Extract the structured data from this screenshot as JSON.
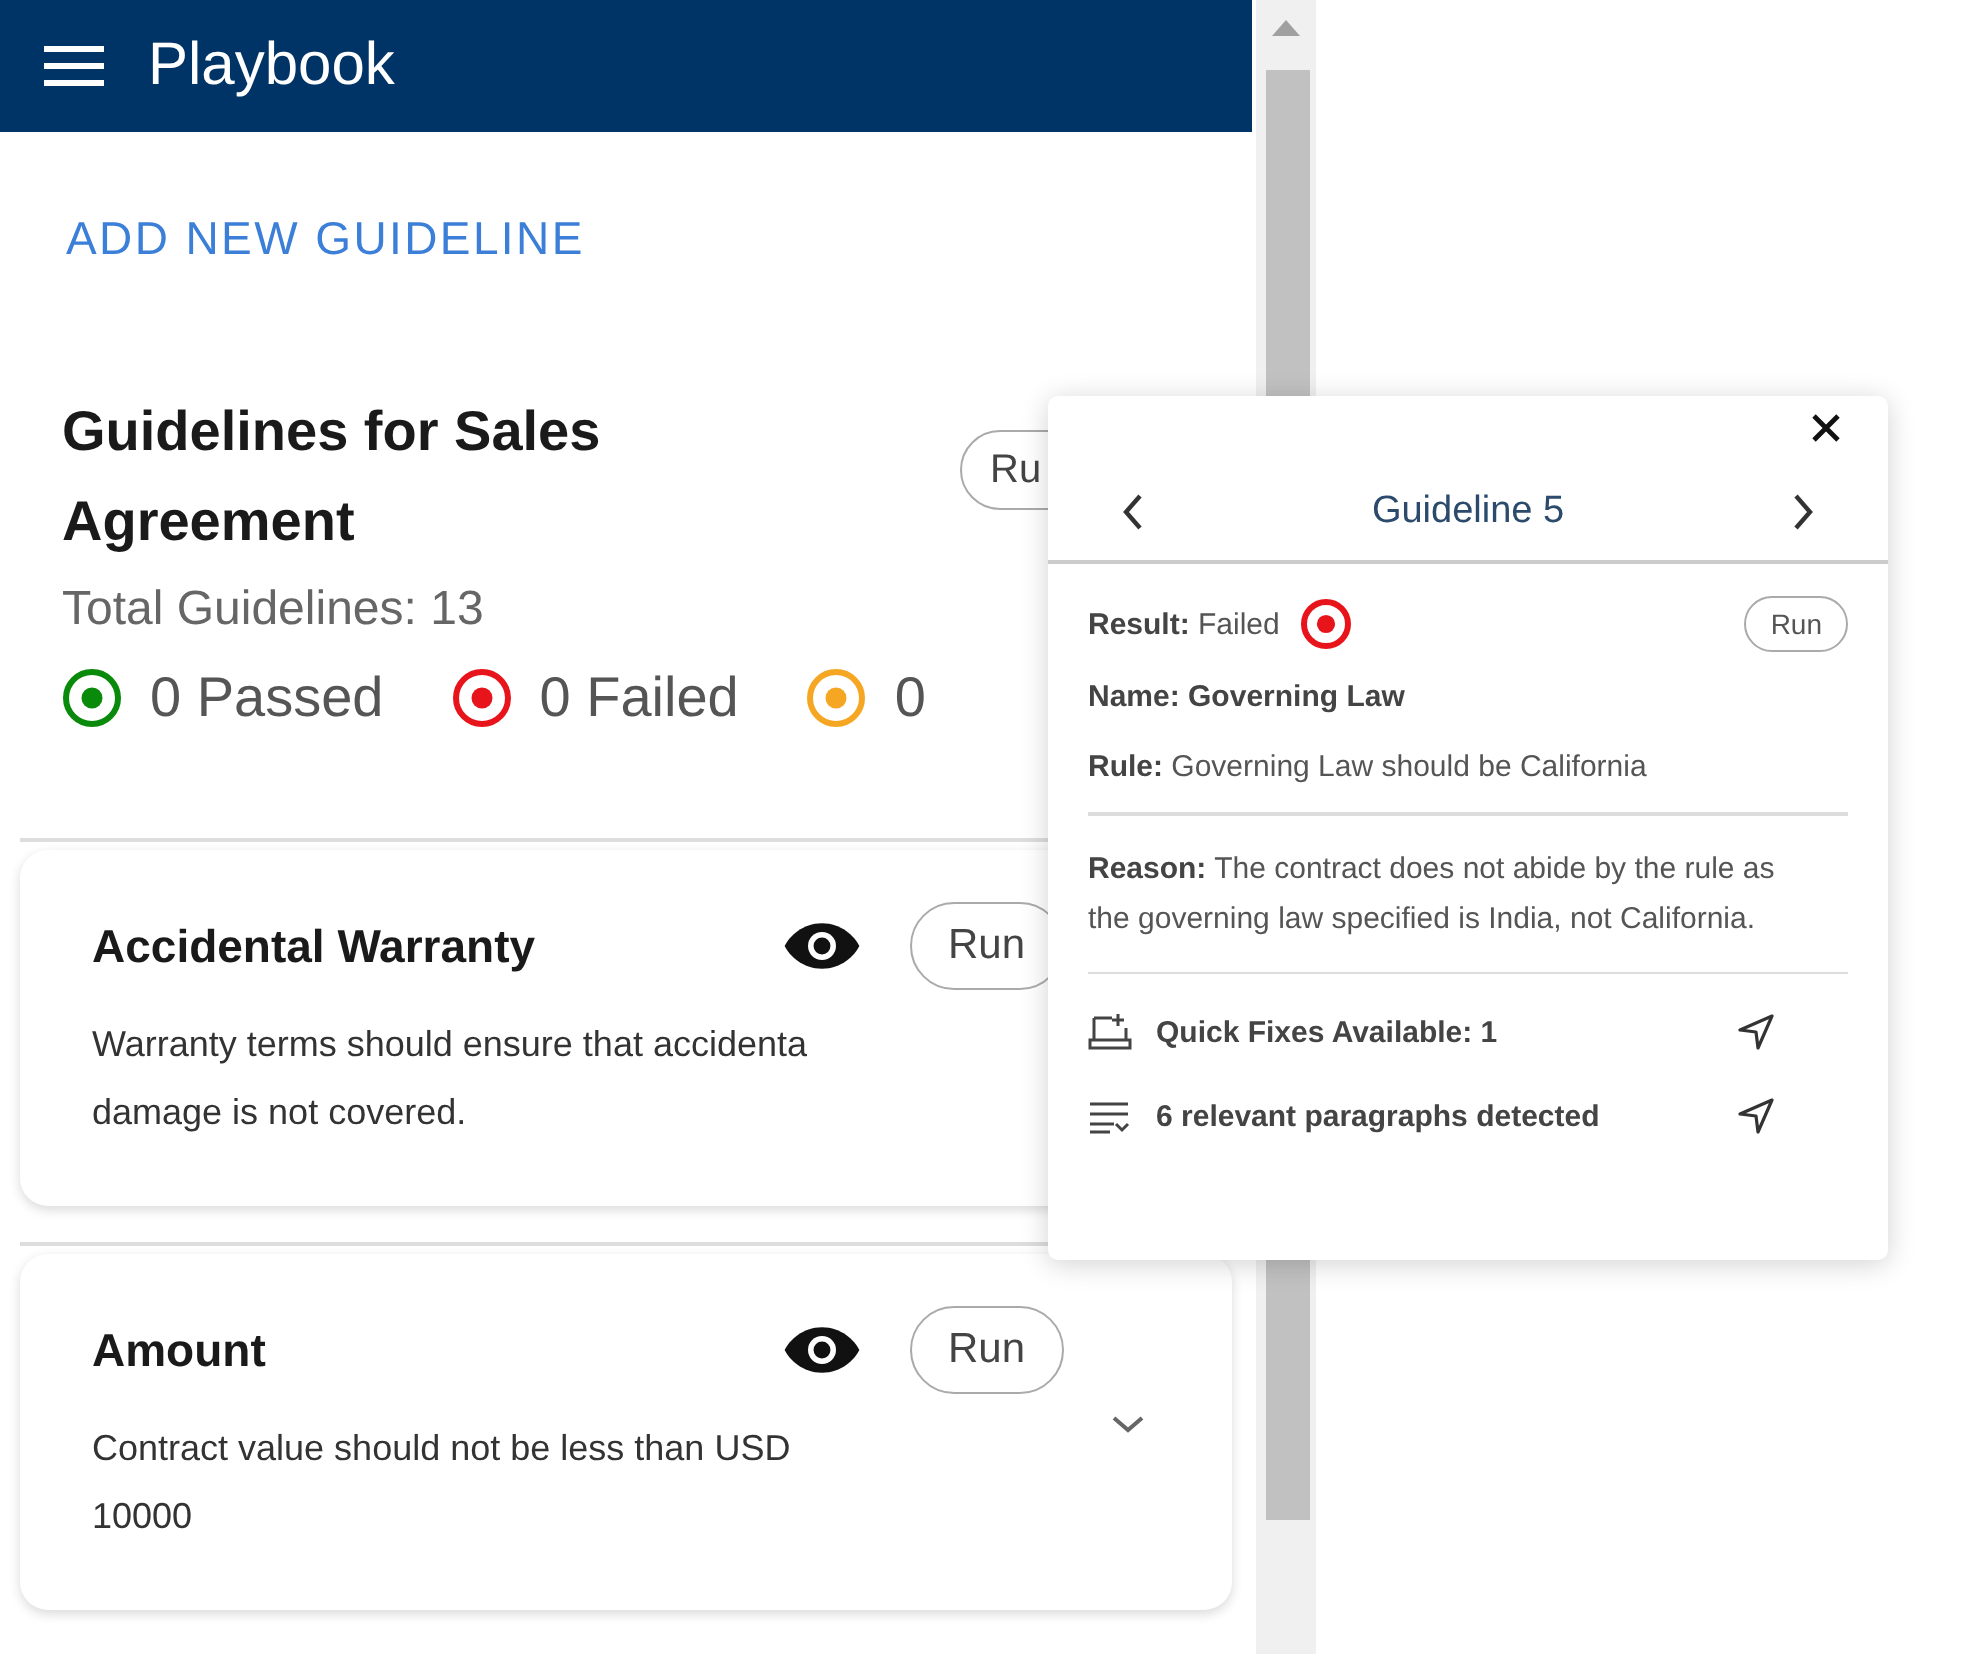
{
  "header": {
    "title": "Playbook"
  },
  "add_link": "ADD NEW GUIDELINE",
  "summary": {
    "title": "Guidelines for Sales Agreement",
    "total": "Total Guidelines: 13",
    "run_label": "Ru",
    "statuses": [
      {
        "label": "0 Passed",
        "color": "#0a8a0a"
      },
      {
        "label": "0 Failed",
        "color": "#e8141b"
      },
      {
        "label": "0",
        "color": "#f5a623"
      }
    ]
  },
  "guidelines": [
    {
      "name": "Accidental Warranty",
      "lines": [
        "Warranty terms should ensure that accidenta",
        "damage is not covered."
      ],
      "run_label": "Run",
      "expandable": false
    },
    {
      "name": "Amount",
      "lines": [
        "Contract value should not be less than USD",
        "10000"
      ],
      "run_label": "Run",
      "expandable": true
    }
  ],
  "popover": {
    "title": "Guideline 5",
    "result": {
      "kind": "failed",
      "text": "**Result:** Failed"
    },
    "run_label": "Run",
    "name": "Name: Governing Law",
    "rule": "**Rule:** Governing Law should be California",
    "reason": "**Reason:** The contract does not abide by the rule as the governing law specified is India, not California.",
    "actions": [
      {
        "kind": "quick-fix",
        "text": "Quick Fixes Available: 1"
      },
      {
        "kind": "paragraphs",
        "text": "6 relevant paragraphs detected"
      }
    ]
  }
}
